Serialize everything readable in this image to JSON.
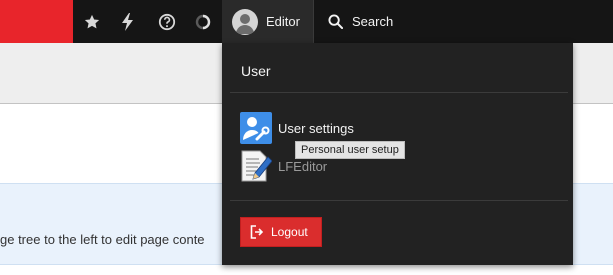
{
  "topbar": {
    "icons": [
      "star-icon",
      "lightning-icon",
      "help-icon",
      "spinner-icon"
    ],
    "user_label": "Editor",
    "search_label": "Search"
  },
  "content": {
    "help_text": "ge tree to the left to edit page conte"
  },
  "user_menu": {
    "title": "User",
    "items": [
      {
        "label": "User settings",
        "icon": "user-settings-icon"
      },
      {
        "label": "LFEditor",
        "icon": "file-edit-icon"
      }
    ],
    "logout_label": "Logout"
  },
  "tooltip": {
    "text": "Personal user setup"
  },
  "colors": {
    "brand": "#e8252b",
    "topbar": "#151515",
    "dropdown": "#222222",
    "logout": "#da2d2d",
    "callout": "#e9f2fc"
  }
}
